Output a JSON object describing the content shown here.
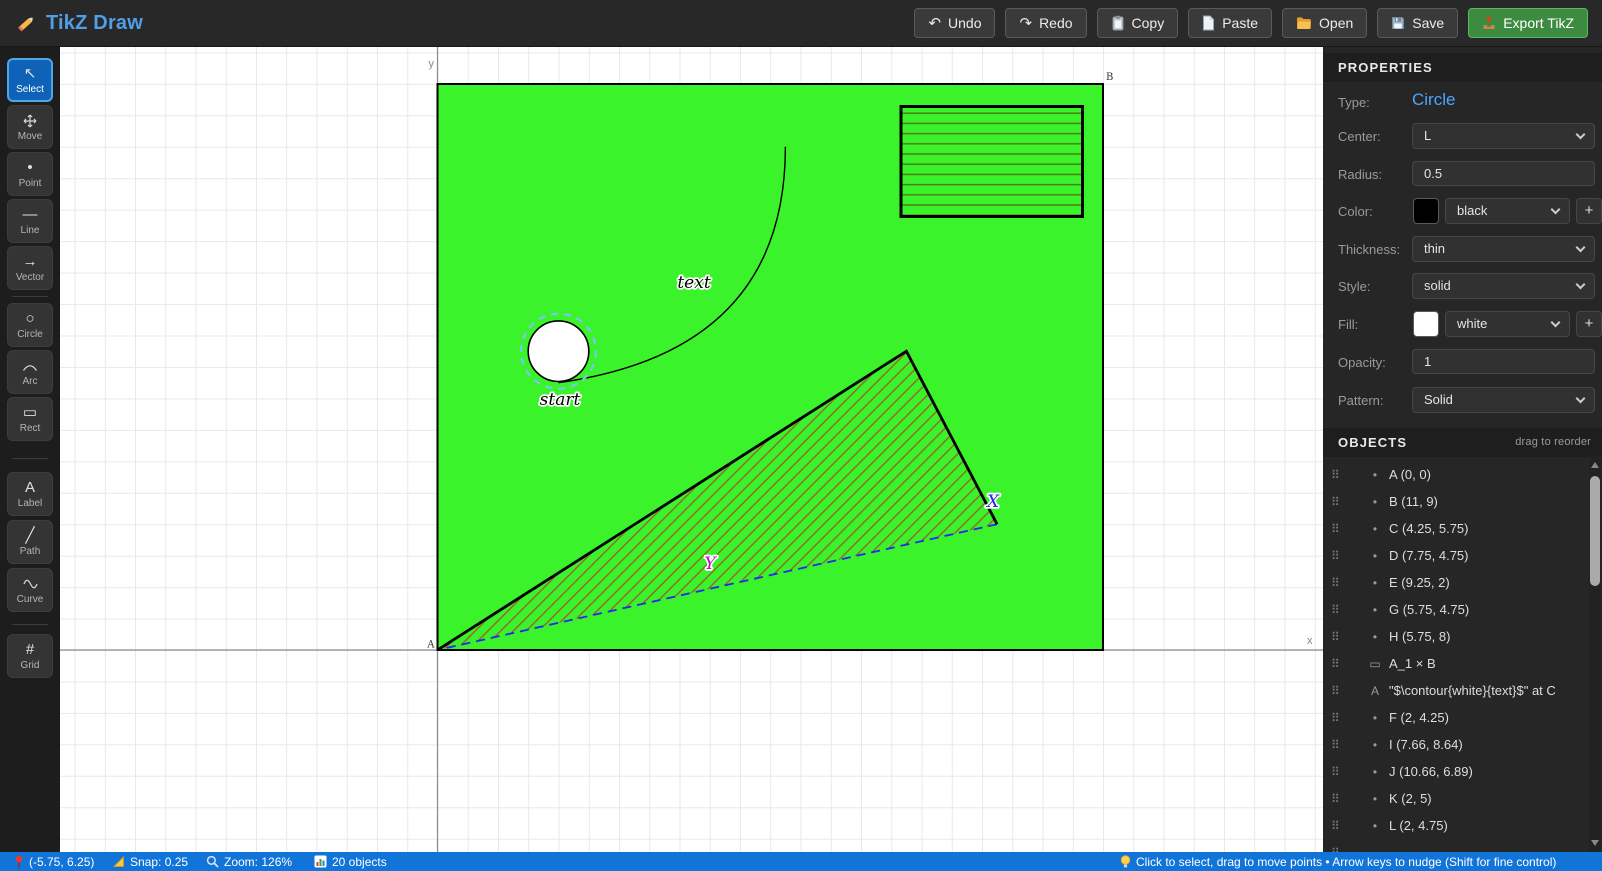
{
  "app": {
    "title": "TikZ Draw"
  },
  "topbar": {
    "buttons": [
      {
        "label": "Undo",
        "icon": "undo-arrow-icon",
        "icon_char": "↶"
      },
      {
        "label": "Redo",
        "icon": "redo-arrow-icon",
        "icon_char": "↷"
      },
      {
        "label": "Copy",
        "icon": "clipboard-icon"
      },
      {
        "label": "Paste",
        "icon": "page-icon"
      },
      {
        "label": "Open",
        "icon": "folder-icon"
      },
      {
        "label": "Save",
        "icon": "floppy-icon"
      },
      {
        "label": "Export TikZ",
        "icon": "export-tray-icon"
      }
    ]
  },
  "toolbar": {
    "items": [
      {
        "label": "Select",
        "icon": "select-arrow-icon",
        "icon_char": "↖",
        "active": true
      },
      {
        "label": "Move",
        "icon": "move-cross-icon"
      },
      {
        "label": "Point",
        "icon": "point-dot-icon",
        "icon_char": "•"
      },
      {
        "label": "Line",
        "icon": "line-icon",
        "icon_char": "—"
      },
      {
        "label": "Vector",
        "icon": "vector-arrow-icon",
        "icon_char": "→"
      },
      {
        "label": "Circle",
        "icon": "circle-icon",
        "icon_char": "○"
      },
      {
        "label": "Arc",
        "icon": "arc-icon"
      },
      {
        "label": "Rect",
        "icon": "rect-icon",
        "icon_char": "▭"
      },
      {
        "label": "Label",
        "icon": "label-a-icon",
        "icon_char": "A"
      },
      {
        "label": "Path",
        "icon": "path-slash-icon",
        "icon_char": "╱"
      },
      {
        "label": "Curve",
        "icon": "curve-wave-icon"
      },
      {
        "label": "Grid",
        "icon": "grid-hash-icon",
        "icon_char": "#"
      }
    ]
  },
  "canvas": {
    "labels": {
      "y_axis": "y",
      "x_axis": "x",
      "corner_a": "A",
      "corner_b": "B",
      "text_label": "text",
      "start_label": "start",
      "x_label": "X",
      "y_label": "Y"
    },
    "colors": {
      "fill_green": "#3bf32b",
      "hatch_brown": "#9d5a26",
      "hatch_green": "#4e7d17",
      "dashed_blue": "#2626ee",
      "selection_blue": "#7ec3f7",
      "label_x_color": "#2626ee",
      "label_y_color": "#cc00cc"
    }
  },
  "properties": {
    "header": "PROPERTIES",
    "type": {
      "label": "Type:",
      "value": "Circle"
    },
    "center": {
      "label": "Center:",
      "value": "L"
    },
    "radius": {
      "label": "Radius:",
      "value": "0.5"
    },
    "color": {
      "label": "Color:",
      "value": "black",
      "swatch": "#000000"
    },
    "thickness": {
      "label": "Thickness:",
      "value": "thin"
    },
    "style": {
      "label": "Style:",
      "value": "solid"
    },
    "fill": {
      "label": "Fill:",
      "value": "white",
      "swatch": "#ffffff"
    },
    "opacity": {
      "label": "Opacity:",
      "value": "1"
    },
    "pattern": {
      "label": "Pattern:",
      "value": "Solid"
    },
    "add_label": "+"
  },
  "objects": {
    "header": "OBJECTS",
    "hint": "drag to reorder",
    "handle_char": "⠿",
    "items": [
      {
        "icon": "•",
        "label": "A (0, 0)"
      },
      {
        "icon": "•",
        "label": "B (11, 9)"
      },
      {
        "icon": "•",
        "label": "C (4.25, 5.75)"
      },
      {
        "icon": "•",
        "label": "D (7.75, 4.75)"
      },
      {
        "icon": "•",
        "label": "E (9.25, 2)"
      },
      {
        "icon": "•",
        "label": "G (5.75, 4.75)"
      },
      {
        "icon": "•",
        "label": "H (5.75, 8)"
      },
      {
        "icon": "▭",
        "label": "A_1 × B"
      },
      {
        "icon": "A",
        "label": "\"$\\contour{white}{text}$\" at C"
      },
      {
        "icon": "•",
        "label": "F (2, 4.25)"
      },
      {
        "icon": "•",
        "label": "I (7.66, 8.64)"
      },
      {
        "icon": "•",
        "label": "J (10.66, 6.89)"
      },
      {
        "icon": "•",
        "label": "K (2, 5)"
      },
      {
        "icon": "•",
        "label": "L (2, 4.75)"
      },
      {
        "icon": "",
        "label": ""
      }
    ]
  },
  "statusbar": {
    "coords": "(-5.75, 6.25)",
    "snap": "Snap: 0.25",
    "zoom": "Zoom: 126%",
    "objects_count": "20 objects",
    "hint": "Click to select, drag to move points • Arrow keys to nudge (Shift for fine control)"
  }
}
